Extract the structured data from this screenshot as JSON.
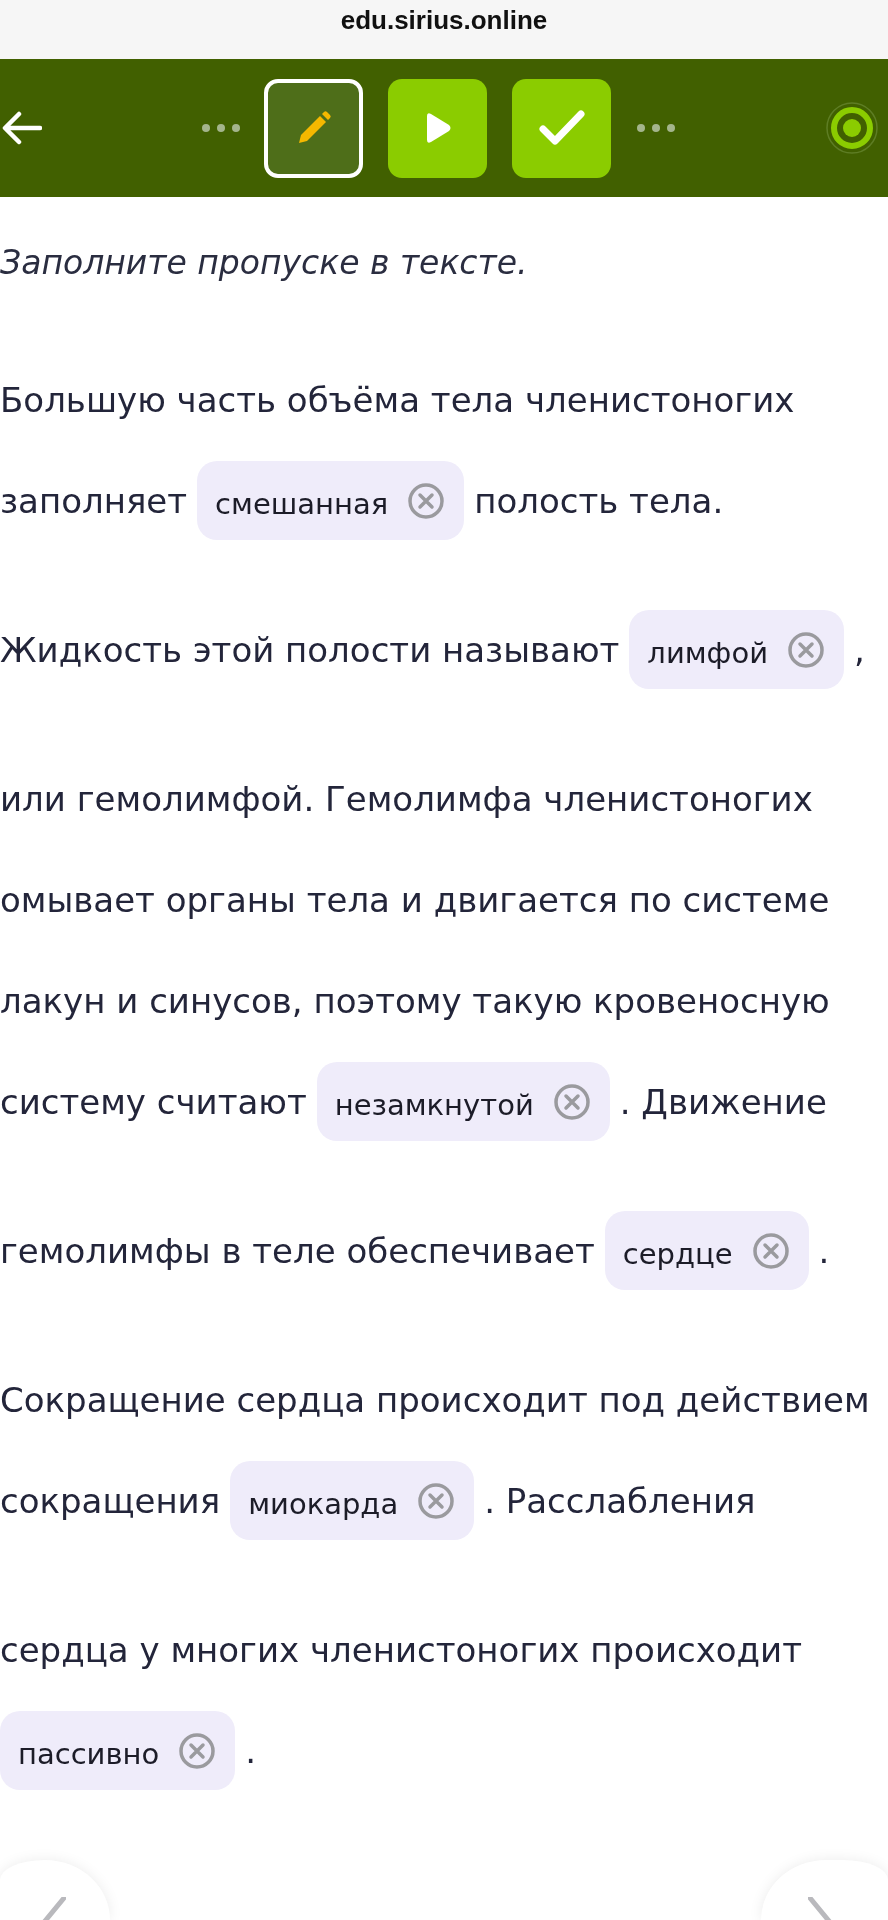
{
  "browser": {
    "url": "edu.sirius.online"
  },
  "toolbar": {
    "steps": [
      {
        "kind": "task",
        "selected": true,
        "completed": false
      },
      {
        "kind": "video",
        "selected": false,
        "completed": true
      },
      {
        "kind": "test",
        "selected": false,
        "completed": true
      }
    ]
  },
  "instruction": "Заполните пропуске в тексте.",
  "passage": {
    "lines": [
      {
        "parts": [
          {
            "kind": "text",
            "text": "Большую часть объёма тела членистоногих"
          }
        ]
      },
      {
        "parts": [
          {
            "kind": "text",
            "text": "заполняет"
          },
          {
            "kind": "blank",
            "value": "смешанная"
          },
          {
            "kind": "text",
            "text": "полость тела."
          }
        ]
      },
      {
        "parts": [
          {
            "kind": "text",
            "text": "Жидкость этой полости называют"
          },
          {
            "kind": "blank",
            "value": "лимфой"
          },
          {
            "kind": "text",
            "text": ","
          }
        ]
      },
      {
        "parts": [
          {
            "kind": "text",
            "text": "или гемолимфой. Гемолимфа членистоногих"
          }
        ]
      },
      {
        "parts": [
          {
            "kind": "text",
            "text": "омывает органы тела и двигается по системе"
          }
        ]
      },
      {
        "parts": [
          {
            "kind": "text",
            "text": "лакун и синусов, поэтому такую кровеносную"
          }
        ]
      },
      {
        "parts": [
          {
            "kind": "text",
            "text": "систему считают"
          },
          {
            "kind": "blank",
            "value": "незамкнутой"
          },
          {
            "kind": "text",
            "text": ". Движение"
          }
        ]
      },
      {
        "parts": [
          {
            "kind": "text",
            "text": "гемолимфы в теле обеспечивает"
          },
          {
            "kind": "blank",
            "value": "сердце"
          },
          {
            "kind": "text",
            "text": "."
          }
        ]
      },
      {
        "parts": [
          {
            "kind": "text",
            "text": "Сокращение сердца происходит под действием"
          }
        ]
      },
      {
        "parts": [
          {
            "kind": "text",
            "text": "сокращения"
          },
          {
            "kind": "blank",
            "value": "миокарда"
          },
          {
            "kind": "text",
            "text": ". Расслабления"
          }
        ]
      },
      {
        "parts": [
          {
            "kind": "text",
            "text": "сердца у многих членистоногих происходит"
          }
        ]
      },
      {
        "parts": [
          {
            "kind": "blank",
            "value": "пассивно"
          },
          {
            "kind": "text",
            "text": "."
          }
        ]
      }
    ]
  }
}
